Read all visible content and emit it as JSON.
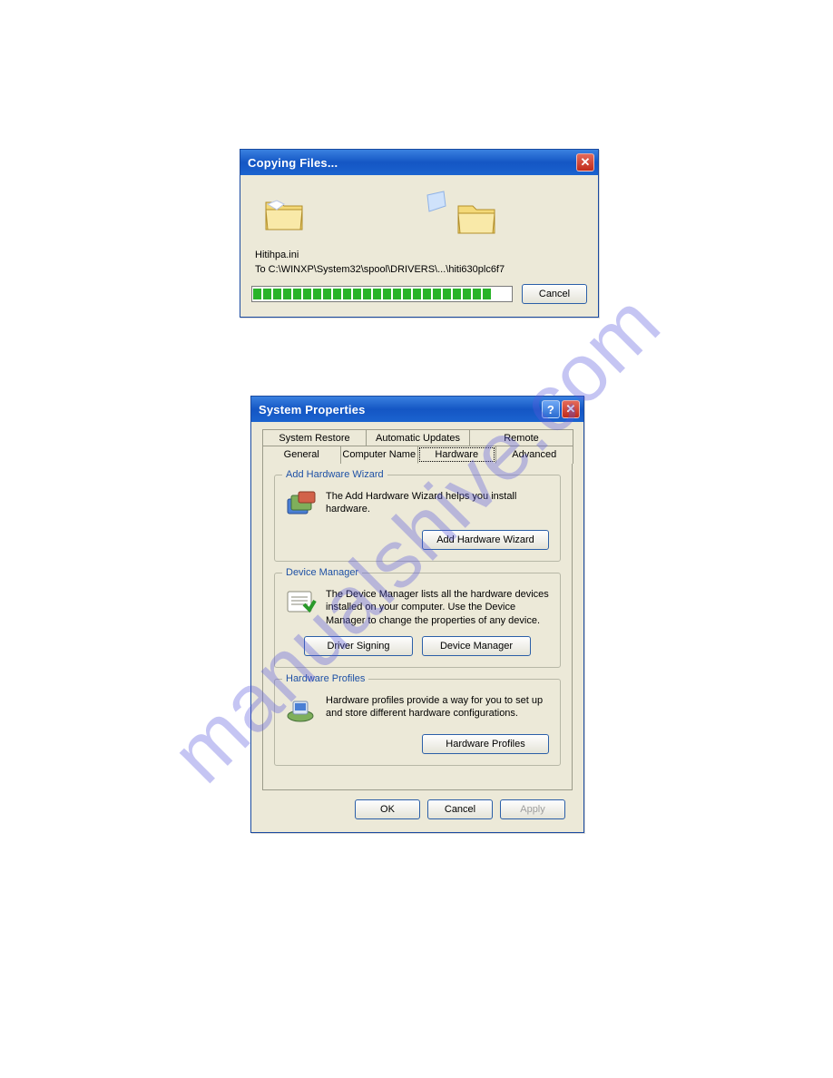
{
  "watermark": "manualshive.com",
  "dialog1": {
    "title": "Copying Files...",
    "filename": "Hitihpa.ini",
    "destination": "To C:\\WINXP\\System32\\spool\\DRIVERS\\...\\hiti630plc6f7",
    "cancel_label": "Cancel",
    "progress_segments": 24
  },
  "dialog2": {
    "title": "System Properties",
    "tabs_row1": [
      "System Restore",
      "Automatic Updates",
      "Remote"
    ],
    "tabs_row2": [
      "General",
      "Computer Name",
      "Hardware",
      "Advanced"
    ],
    "active_tab": "Hardware",
    "group1": {
      "title": "Add Hardware Wizard",
      "text": "The Add Hardware Wizard helps you install hardware.",
      "button": "Add Hardware Wizard"
    },
    "group2": {
      "title": "Device Manager",
      "text": "The Device Manager lists all the hardware devices installed on your computer. Use the Device Manager to change the properties of any device.",
      "button1": "Driver Signing",
      "button2": "Device Manager"
    },
    "group3": {
      "title": "Hardware Profiles",
      "text": "Hardware profiles provide a way for you to set up and store different hardware configurations.",
      "button": "Hardware Profiles"
    },
    "footer": {
      "ok": "OK",
      "cancel": "Cancel",
      "apply": "Apply"
    }
  }
}
